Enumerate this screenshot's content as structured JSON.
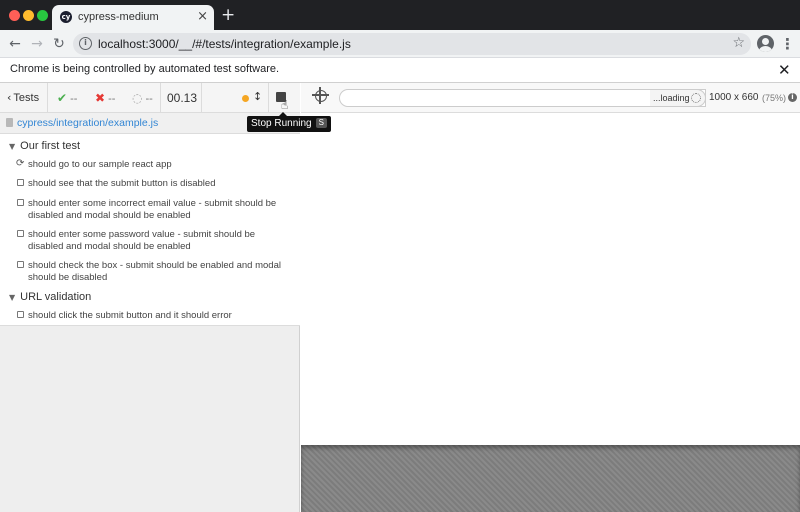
{
  "browser": {
    "tab_title": "cypress-medium",
    "tab_favicon": "cy",
    "tab_close": "×",
    "new_tab": "+",
    "url": "localhost:3000/__/#/tests/integration/example.js",
    "info_icon": "i",
    "back_glyph": "←",
    "forward_glyph": "→",
    "reload_glyph": "↻",
    "star_glyph": "☆",
    "menu_glyph": "⋮"
  },
  "infobar": {
    "message": "Chrome is being controlled by automated test software.",
    "close": "✕"
  },
  "reporter": {
    "back_label": "Tests",
    "back_glyph": "‹",
    "passed": "--",
    "failed": "--",
    "pending": "--",
    "passed_glyph": "✔",
    "failed_glyph": "✖",
    "pending_glyph": "◌",
    "duration": "00.13",
    "scroll_glyph": "↕",
    "tooltip_label": "Stop Running",
    "tooltip_key": "S",
    "spec_path": "cypress/integration/example.js",
    "suites": [
      {
        "title": "Our first test",
        "tests": [
          {
            "title": "should go to our sample react app",
            "state": "running"
          },
          {
            "title": "should see that the submit button is disabled",
            "state": "pending"
          },
          {
            "title": "should enter some incorrect email value - submit should be disabled and modal should be enabled",
            "state": "pending"
          },
          {
            "title": "should enter some password value - submit should be disabled and modal should be enabled",
            "state": "pending"
          },
          {
            "title": "should check the box - submit should be enabled and modal should be disabled",
            "state": "pending"
          }
        ]
      },
      {
        "title": "URL validation",
        "tests": [
          {
            "title": "should click the submit button and it should error",
            "state": "pending"
          }
        ]
      }
    ]
  },
  "app_header": {
    "loading_label": "...loading",
    "viewport_size": "1000 x 660",
    "viewport_scale": "(75%)",
    "info_glyph": "i"
  },
  "colors": {
    "accent_link": "#3386d4",
    "running_dot": "#f5a623",
    "passed": "#4caf50",
    "failed": "#e53935"
  }
}
